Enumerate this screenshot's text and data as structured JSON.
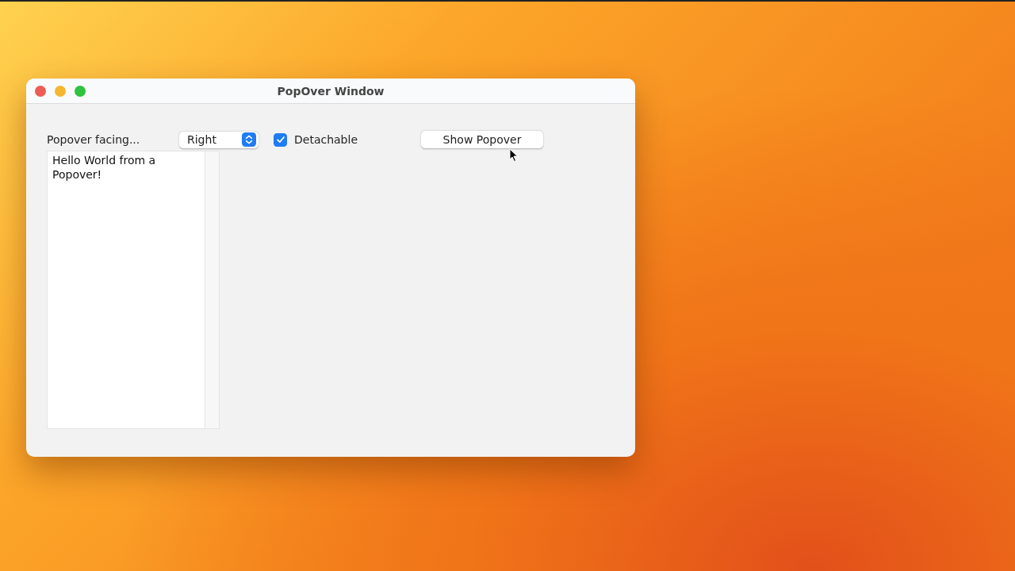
{
  "window": {
    "title": "PopOver Window"
  },
  "toolbar": {
    "facing_label": "Popover facing...",
    "facing_popup": {
      "value": "Right"
    },
    "detachable": {
      "label": "Detachable",
      "checked": true
    },
    "show_button": {
      "label": "Show Popover"
    }
  },
  "text_view": {
    "value": "Hello World from a Popover!"
  }
}
